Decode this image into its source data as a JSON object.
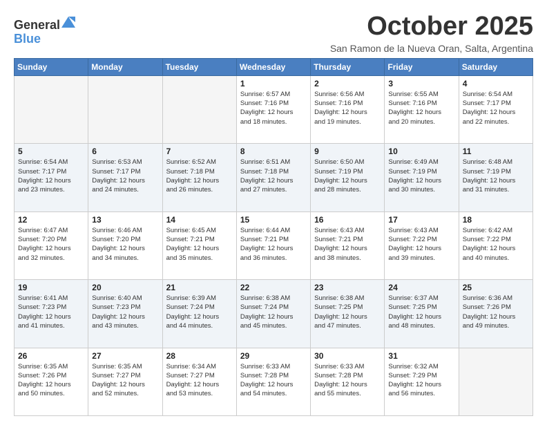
{
  "header": {
    "logo_general": "General",
    "logo_blue": "Blue",
    "month": "October 2025",
    "location": "San Ramon de la Nueva Oran, Salta, Argentina"
  },
  "days_of_week": [
    "Sunday",
    "Monday",
    "Tuesday",
    "Wednesday",
    "Thursday",
    "Friday",
    "Saturday"
  ],
  "weeks": [
    [
      {
        "day": "",
        "info": ""
      },
      {
        "day": "",
        "info": ""
      },
      {
        "day": "",
        "info": ""
      },
      {
        "day": "1",
        "info": "Sunrise: 6:57 AM\nSunset: 7:16 PM\nDaylight: 12 hours\nand 18 minutes."
      },
      {
        "day": "2",
        "info": "Sunrise: 6:56 AM\nSunset: 7:16 PM\nDaylight: 12 hours\nand 19 minutes."
      },
      {
        "day": "3",
        "info": "Sunrise: 6:55 AM\nSunset: 7:16 PM\nDaylight: 12 hours\nand 20 minutes."
      },
      {
        "day": "4",
        "info": "Sunrise: 6:54 AM\nSunset: 7:17 PM\nDaylight: 12 hours\nand 22 minutes."
      }
    ],
    [
      {
        "day": "5",
        "info": "Sunrise: 6:54 AM\nSunset: 7:17 PM\nDaylight: 12 hours\nand 23 minutes."
      },
      {
        "day": "6",
        "info": "Sunrise: 6:53 AM\nSunset: 7:17 PM\nDaylight: 12 hours\nand 24 minutes."
      },
      {
        "day": "7",
        "info": "Sunrise: 6:52 AM\nSunset: 7:18 PM\nDaylight: 12 hours\nand 26 minutes."
      },
      {
        "day": "8",
        "info": "Sunrise: 6:51 AM\nSunset: 7:18 PM\nDaylight: 12 hours\nand 27 minutes."
      },
      {
        "day": "9",
        "info": "Sunrise: 6:50 AM\nSunset: 7:19 PM\nDaylight: 12 hours\nand 28 minutes."
      },
      {
        "day": "10",
        "info": "Sunrise: 6:49 AM\nSunset: 7:19 PM\nDaylight: 12 hours\nand 30 minutes."
      },
      {
        "day": "11",
        "info": "Sunrise: 6:48 AM\nSunset: 7:19 PM\nDaylight: 12 hours\nand 31 minutes."
      }
    ],
    [
      {
        "day": "12",
        "info": "Sunrise: 6:47 AM\nSunset: 7:20 PM\nDaylight: 12 hours\nand 32 minutes."
      },
      {
        "day": "13",
        "info": "Sunrise: 6:46 AM\nSunset: 7:20 PM\nDaylight: 12 hours\nand 34 minutes."
      },
      {
        "day": "14",
        "info": "Sunrise: 6:45 AM\nSunset: 7:21 PM\nDaylight: 12 hours\nand 35 minutes."
      },
      {
        "day": "15",
        "info": "Sunrise: 6:44 AM\nSunset: 7:21 PM\nDaylight: 12 hours\nand 36 minutes."
      },
      {
        "day": "16",
        "info": "Sunrise: 6:43 AM\nSunset: 7:21 PM\nDaylight: 12 hours\nand 38 minutes."
      },
      {
        "day": "17",
        "info": "Sunrise: 6:43 AM\nSunset: 7:22 PM\nDaylight: 12 hours\nand 39 minutes."
      },
      {
        "day": "18",
        "info": "Sunrise: 6:42 AM\nSunset: 7:22 PM\nDaylight: 12 hours\nand 40 minutes."
      }
    ],
    [
      {
        "day": "19",
        "info": "Sunrise: 6:41 AM\nSunset: 7:23 PM\nDaylight: 12 hours\nand 41 minutes."
      },
      {
        "day": "20",
        "info": "Sunrise: 6:40 AM\nSunset: 7:23 PM\nDaylight: 12 hours\nand 43 minutes."
      },
      {
        "day": "21",
        "info": "Sunrise: 6:39 AM\nSunset: 7:24 PM\nDaylight: 12 hours\nand 44 minutes."
      },
      {
        "day": "22",
        "info": "Sunrise: 6:38 AM\nSunset: 7:24 PM\nDaylight: 12 hours\nand 45 minutes."
      },
      {
        "day": "23",
        "info": "Sunrise: 6:38 AM\nSunset: 7:25 PM\nDaylight: 12 hours\nand 47 minutes."
      },
      {
        "day": "24",
        "info": "Sunrise: 6:37 AM\nSunset: 7:25 PM\nDaylight: 12 hours\nand 48 minutes."
      },
      {
        "day": "25",
        "info": "Sunrise: 6:36 AM\nSunset: 7:26 PM\nDaylight: 12 hours\nand 49 minutes."
      }
    ],
    [
      {
        "day": "26",
        "info": "Sunrise: 6:35 AM\nSunset: 7:26 PM\nDaylight: 12 hours\nand 50 minutes."
      },
      {
        "day": "27",
        "info": "Sunrise: 6:35 AM\nSunset: 7:27 PM\nDaylight: 12 hours\nand 52 minutes."
      },
      {
        "day": "28",
        "info": "Sunrise: 6:34 AM\nSunset: 7:27 PM\nDaylight: 12 hours\nand 53 minutes."
      },
      {
        "day": "29",
        "info": "Sunrise: 6:33 AM\nSunset: 7:28 PM\nDaylight: 12 hours\nand 54 minutes."
      },
      {
        "day": "30",
        "info": "Sunrise: 6:33 AM\nSunset: 7:28 PM\nDaylight: 12 hours\nand 55 minutes."
      },
      {
        "day": "31",
        "info": "Sunrise: 6:32 AM\nSunset: 7:29 PM\nDaylight: 12 hours\nand 56 minutes."
      },
      {
        "day": "",
        "info": ""
      }
    ]
  ]
}
